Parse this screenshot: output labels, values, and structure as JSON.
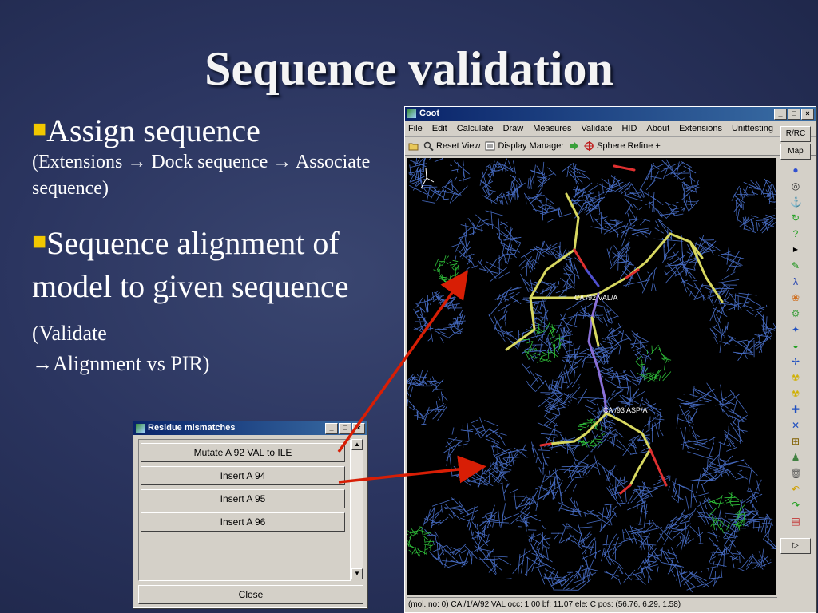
{
  "slide": {
    "title": "Sequence validation",
    "bullet1_title": "Assign sequence",
    "bullet1_sub": "(Extensions → Dock sequence → Associate sequence)",
    "bullet2_text": "Sequence alignment of model to given sequence",
    "bullet2_sub_a": "(Validate",
    "bullet2_sub_b": "→Alignment vs PIR)"
  },
  "coot": {
    "title": "Coot",
    "menu": [
      "File",
      "Edit",
      "Calculate",
      "Draw",
      "Measures",
      "Validate",
      "HID",
      "About",
      "Extensions",
      "Unittesting"
    ],
    "toolbar": {
      "reset_view": "Reset View",
      "display_manager": "Display Manager",
      "sphere_refine": "Sphere Refine +"
    },
    "labels": {
      "residue1": "CA /92 VAL/A",
      "residue2": "CA /93 ASP/A"
    },
    "status": "(mol. no: 0)  CA /1/A/92 VAL occ:  1.00 bf: 11.07 ele:  C pos: (56.76, 6.29, 1.58)",
    "sidebar_buttons": [
      "R/RC",
      "Map"
    ]
  },
  "residue_mismatches": {
    "title": "Residue mismatches",
    "buttons": [
      "Mutate A 92 VAL to ILE",
      "Insert A 94",
      "Insert A 95",
      "Insert A 96"
    ],
    "close": "Close"
  },
  "colors": {
    "accent_bullet": "#f2c800",
    "arrow": "#d81e05",
    "mesh_blue": "#4f78d8",
    "mesh_green": "#2fbf3a",
    "backbone": "#d8d860"
  }
}
